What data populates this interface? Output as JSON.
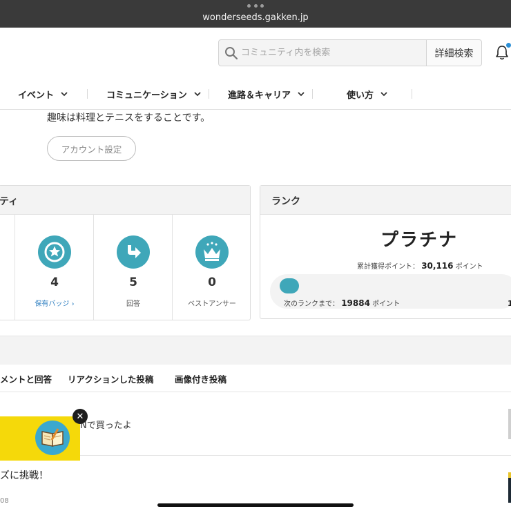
{
  "browser": {
    "url": "wonderseeds.gakken.jp"
  },
  "header": {
    "search_placeholder": "コミュニティ内を検索",
    "advanced_search_label": "詳細検索"
  },
  "nav": {
    "items": [
      {
        "label": "イベント"
      },
      {
        "label": "コミュニケーション"
      },
      {
        "label": "進路＆キャリア"
      },
      {
        "label": "使い方"
      }
    ]
  },
  "profile": {
    "bio": "趣味は料理とテニスをすることです。",
    "account_settings_label": "アカウント設定"
  },
  "activity": {
    "title": "ティ",
    "stats": [
      {
        "value": "4",
        "label": "保有バッジ ›",
        "icon": "badge-star-icon"
      },
      {
        "value": "5",
        "label": "回答",
        "icon": "reply-arrow-icon"
      },
      {
        "value": "0",
        "label": "ベストアンサー",
        "icon": "crown-icon"
      }
    ]
  },
  "rank": {
    "title": "ランク",
    "name": "プラチナ",
    "total_points_label": "累計獲得ポイント：",
    "total_points_value": "30,116",
    "points_unit": "ポイント",
    "next_rank_label": "次のランクまで：",
    "next_rank_value": "19884",
    "next_rank_right": "1",
    "progress_fraction": 0.08
  },
  "tabs": [
    {
      "label": "メントと回答"
    },
    {
      "label": "リアクションした投稿"
    },
    {
      "label": "画像付き投稿"
    }
  ],
  "posts": [
    {
      "text": "Nで買ったよ"
    },
    {
      "title": "ズに挑戦！",
      "meta": "08"
    }
  ],
  "ad": {
    "close_symbol": "✕"
  },
  "colors": {
    "accent": "#3fa7b9",
    "ad_bg": "#f5d90a",
    "link": "#2f7fc1"
  }
}
